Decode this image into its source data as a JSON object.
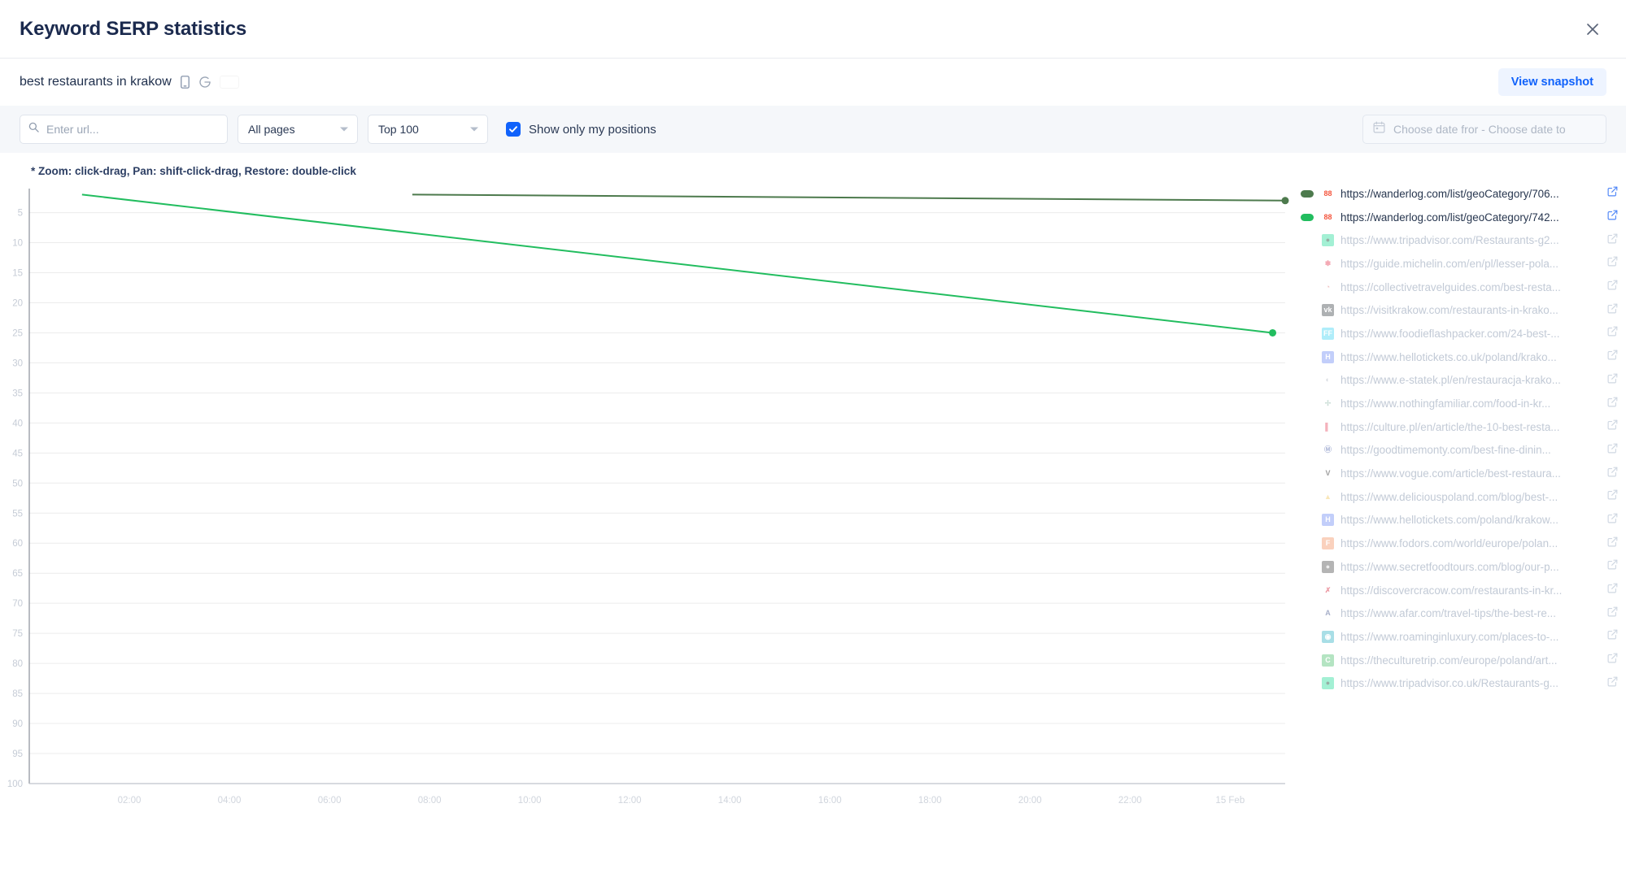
{
  "header": {
    "title": "Keyword SERP statistics",
    "close_icon": "close-icon"
  },
  "keyword": {
    "text": "best restaurants in krakow",
    "device_icon": "mobile-icon",
    "engine_icon": "google-icon",
    "country_flag": "poland-flag-icon",
    "view_snapshot_label": "View snapshot"
  },
  "filters": {
    "url_placeholder": "Enter url...",
    "url_value": "",
    "search_icon": "search-icon",
    "pages_select": "All pages",
    "top_select": "Top 100",
    "checkbox_label": "Show only my positions",
    "checkbox_checked": true,
    "date_placeholder": "Choose date fror - Choose date to",
    "calendar_icon": "calendar-icon"
  },
  "chart_hint": "* Zoom: click-drag, Pan: shift-click-drag, Restore: double-click",
  "chart_data": {
    "type": "line",
    "title": "",
    "xlabel": "",
    "ylabel": "",
    "grid": true,
    "legend_position": "right",
    "y_inverted": true,
    "ylim": [
      1,
      100
    ],
    "yticks": [
      5,
      10,
      15,
      20,
      25,
      30,
      35,
      40,
      45,
      50,
      55,
      60,
      65,
      70,
      75,
      80,
      85,
      90,
      95,
      100
    ],
    "xticks": [
      "02:00",
      "04:00",
      "06:00",
      "08:00",
      "10:00",
      "12:00",
      "14:00",
      "16:00",
      "18:00",
      "20:00",
      "22:00",
      "15 Feb"
    ],
    "series": [
      {
        "name": "https://wanderlog.com/list/geoCategory/706...",
        "color": "#4d7a4d",
        "points": [
          {
            "x": 0.305,
            "y": 2
          },
          {
            "x": 1.0,
            "y": 3
          }
        ]
      },
      {
        "name": "https://wanderlog.com/list/geoCategory/742...",
        "color": "#22bd5f",
        "points": [
          {
            "x": 0.042,
            "y": 2
          },
          {
            "x": 0.99,
            "y": 25
          }
        ]
      }
    ]
  },
  "legend": {
    "items": [
      {
        "url": "https://wanderlog.com/list/geoCategory/706...",
        "active": true,
        "swatch": "#4d7a4d",
        "icon_text": "88",
        "icon_bg": "#ffffff",
        "icon_fg": "#f4553d",
        "icon_name": "wanderlog-favicon"
      },
      {
        "url": "https://wanderlog.com/list/geoCategory/742...",
        "active": true,
        "swatch": "#22bd5f",
        "icon_text": "88",
        "icon_bg": "#ffffff",
        "icon_fg": "#f4553d",
        "icon_name": "wanderlog-favicon"
      },
      {
        "url": "https://www.tripadvisor.com/Restaurants-g2...",
        "active": false,
        "swatch": "",
        "icon_text": "●",
        "icon_bg": "#34e0a1",
        "icon_fg": "#1a4c3a",
        "icon_name": "tripadvisor-favicon"
      },
      {
        "url": "https://guide.michelin.com/en/pl/lesser-pola...",
        "active": false,
        "swatch": "",
        "icon_text": "✽",
        "icon_bg": "#ffffff",
        "icon_fg": "#e8435a",
        "icon_name": "michelin-favicon"
      },
      {
        "url": "https://collectivetravelguides.com/best-resta...",
        "active": false,
        "swatch": "",
        "icon_text": "◔",
        "icon_bg": "#ffffff",
        "icon_fg": "#e07a7a",
        "icon_name": "collectivetravelguides-favicon"
      },
      {
        "url": "https://visitkrakow.com/restaurants-in-krako...",
        "active": false,
        "swatch": "",
        "icon_text": "vk",
        "icon_bg": "#4e5459",
        "icon_fg": "#ffffff",
        "icon_name": "visitkrakow-favicon"
      },
      {
        "url": "https://www.foodieflashpacker.com/24-best-...",
        "active": false,
        "swatch": "",
        "icon_text": "FF",
        "icon_bg": "#4fd8f5",
        "icon_fg": "#ffffff",
        "icon_name": "foodieflashpacker-favicon"
      },
      {
        "url": "https://www.hellotickets.co.uk/poland/krako...",
        "active": false,
        "swatch": "",
        "icon_text": "H",
        "icon_bg": "#7a94f5",
        "icon_fg": "#ffffff",
        "icon_name": "hellotickets-favicon"
      },
      {
        "url": "https://www.e-statek.pl/en/restauracja-krako...",
        "active": false,
        "swatch": "",
        "icon_text": "◐",
        "icon_bg": "#ffffff",
        "icon_fg": "#a7b0bd",
        "icon_name": "globe-favicon"
      },
      {
        "url": "https://www.nothingfamiliar.com/food-in-kr...",
        "active": false,
        "swatch": "",
        "icon_text": "✢",
        "icon_bg": "#ffffff",
        "icon_fg": "#8fb8a8",
        "icon_name": "nothingfamiliar-favicon"
      },
      {
        "url": "https://culture.pl/en/article/the-10-best-resta...",
        "active": false,
        "swatch": "",
        "icon_text": "▌",
        "icon_bg": "#ffffff",
        "icon_fg": "#e8536a",
        "icon_name": "culturepl-favicon"
      },
      {
        "url": "https://goodtimemonty.com/best-fine-dinin...",
        "active": false,
        "swatch": "",
        "icon_text": "Ⓜ",
        "icon_bg": "#ffffff",
        "icon_fg": "#4a5fa8",
        "icon_name": "goodtimemonty-favicon"
      },
      {
        "url": "https://www.vogue.com/article/best-restaura...",
        "active": false,
        "swatch": "",
        "icon_text": "V",
        "icon_bg": "#ffffff",
        "icon_fg": "#2b2b2b",
        "icon_name": "vogue-favicon"
      },
      {
        "url": "https://www.deliciouspoland.com/blog/best-...",
        "active": false,
        "swatch": "",
        "icon_text": "▲",
        "icon_bg": "#ffffff",
        "icon_fg": "#f3cb68",
        "icon_name": "deliciouspoland-favicon"
      },
      {
        "url": "https://www.hellotickets.com/poland/krakow...",
        "active": false,
        "swatch": "",
        "icon_text": "H",
        "icon_bg": "#7a94f5",
        "icon_fg": "#ffffff",
        "icon_name": "hellotickets-favicon"
      },
      {
        "url": "https://www.fodors.com/world/europe/polan...",
        "active": false,
        "swatch": "",
        "icon_text": "F",
        "icon_bg": "#f59b6e",
        "icon_fg": "#ffffff",
        "icon_name": "fodors-favicon"
      },
      {
        "url": "https://www.secretfoodtours.com/blog/our-p...",
        "active": false,
        "swatch": "",
        "icon_text": "●",
        "icon_bg": "#5a5a5a",
        "icon_fg": "#d8d8d8",
        "icon_name": "secretfoodtours-favicon"
      },
      {
        "url": "https://discovercracow.com/restaurants-in-kr...",
        "active": false,
        "swatch": "",
        "icon_text": "✗",
        "icon_bg": "#ffffff",
        "icon_fg": "#d8263c",
        "icon_name": "discovercracow-favicon"
      },
      {
        "url": "https://www.afar.com/travel-tips/the-best-re...",
        "active": false,
        "swatch": "",
        "icon_text": "A",
        "icon_bg": "#ffffff",
        "icon_fg": "#3d4f8a",
        "icon_name": "afar-favicon"
      },
      {
        "url": "https://www.roaminginluxury.com/places-to-...",
        "active": false,
        "swatch": "",
        "icon_text": "◉",
        "icon_bg": "#3fb8c8",
        "icon_fg": "#ffffff",
        "icon_name": "roaminginluxury-favicon"
      },
      {
        "url": "https://theculturetrip.com/europe/poland/art...",
        "active": false,
        "swatch": "",
        "icon_text": "C",
        "icon_bg": "#5bc47a",
        "icon_fg": "#ffffff",
        "icon_name": "theculturetrip-favicon"
      },
      {
        "url": "https://www.tripadvisor.co.uk/Restaurants-g...",
        "active": false,
        "swatch": "",
        "icon_text": "●",
        "icon_bg": "#34e0a1",
        "icon_fg": "#1a4c3a",
        "icon_name": "tripadvisor-favicon"
      }
    ]
  }
}
